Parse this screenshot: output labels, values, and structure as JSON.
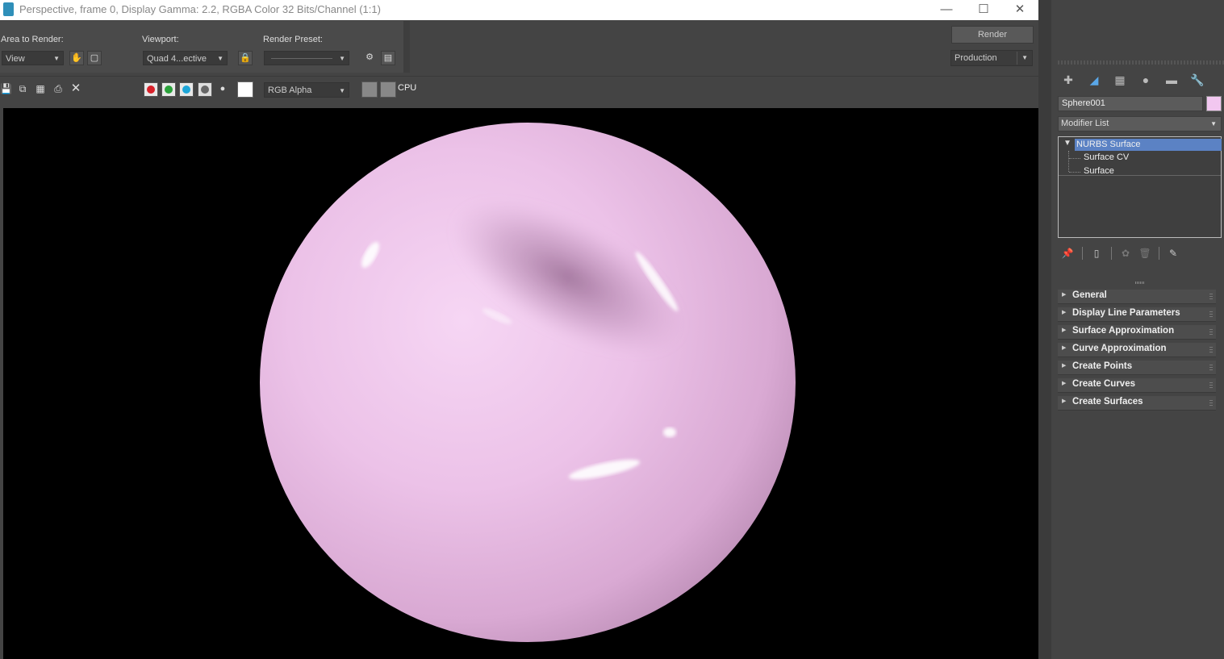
{
  "window": {
    "title": "Perspective, frame 0, Display Gamma: 2.2, RGBA Color 32 Bits/Channel (1:1)"
  },
  "settings": {
    "area_label": "Area to Render:",
    "area_value": "View",
    "viewport_label": "Viewport:",
    "viewport_value": "Quad 4...ective",
    "preset_label": "Render Preset:",
    "preset_value": "",
    "render_button": "Render",
    "render_mode": "Production"
  },
  "toolbar": {
    "channel_value": "RGB Alpha",
    "renderer": "CPU",
    "channel_colors": {
      "red": "#d8212a",
      "green": "#2aa13a",
      "blue": "#1da6d8"
    }
  },
  "render": {
    "background": "#000000",
    "object_color": "#f2c7f0"
  },
  "command_panel": {
    "tabs": [
      "create-icon",
      "modify-icon",
      "hierarchy-icon",
      "motion-icon",
      "display-icon",
      "utilities-icon"
    ],
    "object_name": "Sphere001",
    "object_color": "#f2c7f0",
    "modifier_list": "Modifier List",
    "stack": {
      "selected": "NURBS Surface",
      "children": [
        "Surface CV",
        "Surface"
      ]
    },
    "rollouts": [
      "General",
      "Display Line Parameters",
      "Surface Approximation",
      "Curve Approximation",
      "Create Points",
      "Create Curves",
      "Create Surfaces"
    ]
  }
}
